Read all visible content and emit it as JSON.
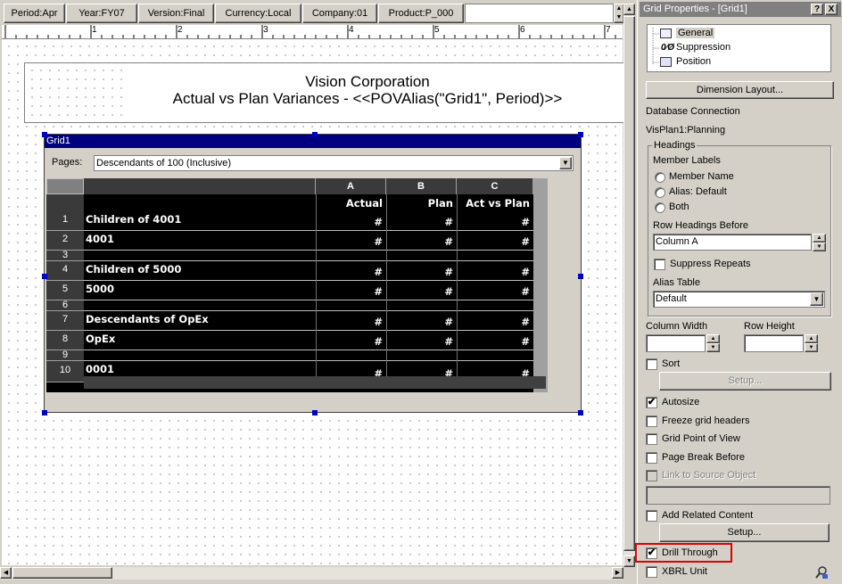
{
  "pov": {
    "items": [
      "Period:Apr",
      "Year:FY07",
      "Version:Final",
      "Currency:Local",
      "Company:01",
      "Product:P_000"
    ]
  },
  "ruler": {
    "marks": [
      "1",
      "2",
      "3",
      "4",
      "5",
      "6",
      "7"
    ]
  },
  "report": {
    "title_line1": "Vision Corporation",
    "title_line2": "Actual vs Plan Variances - <<POVAlias(\"Grid1\", Period)>>"
  },
  "grid": {
    "name": "Grid1",
    "pages_label": "Pages:",
    "pages_value": "Descendants of 100 (Inclusive)",
    "columns": [
      "A",
      "B",
      "C"
    ],
    "column_headings": [
      "Actual",
      "Plan",
      "Act vs Plan"
    ],
    "rows": [
      {
        "num": "1",
        "label": "Children of 4001",
        "values": [
          "#",
          "#",
          "#"
        ]
      },
      {
        "num": "2",
        "label": "4001",
        "values": [
          "#",
          "#",
          "#"
        ]
      },
      {
        "num": "3",
        "label": "",
        "values": [
          "",
          "",
          ""
        ]
      },
      {
        "num": "4",
        "label": "Children of 5000",
        "values": [
          "#",
          "#",
          "#"
        ]
      },
      {
        "num": "5",
        "label": "5000",
        "values": [
          "#",
          "#",
          "#"
        ]
      },
      {
        "num": "6",
        "label": "",
        "values": [
          "",
          "",
          ""
        ]
      },
      {
        "num": "7",
        "label": "Descendants of OpEx",
        "values": [
          "#",
          "#",
          "#"
        ]
      },
      {
        "num": "8",
        "label": "OpEx",
        "values": [
          "#",
          "#",
          "#"
        ]
      },
      {
        "num": "9",
        "label": "",
        "values": [
          "",
          "",
          ""
        ]
      },
      {
        "num": "10",
        "label": "0001",
        "values": [
          "#",
          "#",
          "#"
        ]
      }
    ]
  },
  "properties": {
    "title": "Grid Properties - [Grid1]",
    "help_btn": "?",
    "close_btn": "X",
    "tree": [
      "General",
      "Suppression",
      "Position"
    ],
    "dimension_layout": "Dimension Layout...",
    "db_connection_label": "Database Connection",
    "db_connection_value": "VisPlan1:Planning",
    "headings_group": "Headings",
    "member_labels": "Member Labels",
    "radio_member_name": "Member Name",
    "radio_alias": "Alias: Default",
    "radio_both": "Both",
    "row_headings_before": "Row Headings Before",
    "row_headings_value": "Column A",
    "suppress_repeats": "Suppress Repeats",
    "alias_table": "Alias Table",
    "alias_table_value": "Default",
    "column_width": "Column Width",
    "row_height": "Row Height",
    "sort": "Sort",
    "setup1": "Setup...",
    "autosize": "Autosize",
    "freeze": "Freeze grid headers",
    "grid_pov": "Grid Point of View",
    "page_break": "Page Break Before",
    "link_source": "Link to Source Object",
    "add_related": "Add Related Content",
    "setup2": "Setup...",
    "drill_through": "Drill Through",
    "xbrl": "XBRL Unit",
    "checked": "✔"
  }
}
